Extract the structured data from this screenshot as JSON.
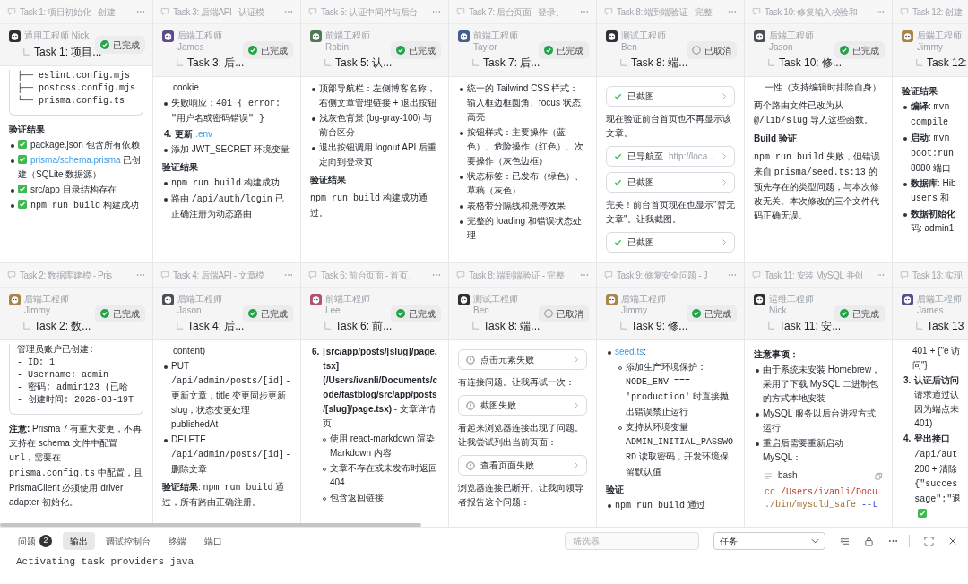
{
  "cards": [
    {
      "title": "Task 1: 项目初始化 - 创建",
      "more_button": true,
      "agent": {
        "role": "通用工程师 Nick",
        "color": "#2f2f33"
      },
      "subtask": "Task 1: 项目...",
      "cancelled": false,
      "status": "已完成",
      "body": [
        {
          "kind": "code",
          "lines": [
            "├── eslint.config.mjs",
            "├── postcss.config.mjs",
            "└── prisma.config.ts"
          ]
        },
        {
          "kind": "heading",
          "text": "验证结果"
        },
        {
          "kind": "bullet",
          "check": true,
          "parts": [
            {
              "text": "package.json 包含所有依赖",
              "kind": "plain"
            }
          ]
        },
        {
          "kind": "bullet",
          "check": true,
          "parts": [
            {
              "text": "prisma/schema.prisma",
              "kind": "link"
            },
            {
              "text": " 已创建（SQLite 数据源）",
              "kind": "plain"
            }
          ]
        },
        {
          "kind": "bullet",
          "check": true,
          "parts": [
            {
              "text": "src/app 目录结构存在",
              "kind": "plain"
            }
          ]
        },
        {
          "kind": "bullet",
          "check": true,
          "parts": [
            {
              "text": "npm run build",
              "kind": "code"
            },
            {
              "text": " 构建成功",
              "kind": "plain"
            }
          ]
        }
      ]
    },
    {
      "title": "Task 3: 后端API - 认证模",
      "more_button": true,
      "agent": {
        "role": "后端工程师 James",
        "color": "#5b4a8c"
      },
      "subtask": "Task 3: 后...",
      "cancelled": false,
      "status": "已完成",
      "body": [
        {
          "kind": "cont",
          "parts": [
            {
              "text": "cookie",
              "kind": "plain"
            }
          ]
        },
        {
          "kind": "bullet",
          "parts": [
            {
              "text": "失败响应：",
              "kind": "plain"
            },
            {
              "text": "401 { error: \"用户名或密码错误\" }",
              "kind": "code"
            }
          ]
        },
        {
          "kind": "numbered",
          "number": "4.",
          "parts": [
            {
              "text": "更新 ",
              "kind": "bold"
            },
            {
              "text": ".env",
              "kind": "link"
            }
          ]
        },
        {
          "kind": "bullet",
          "parts": [
            {
              "text": "添加 JWT_SECRET 环境变量",
              "kind": "plain"
            }
          ]
        },
        {
          "kind": "heading",
          "text": "验证结果"
        },
        {
          "kind": "bullet",
          "parts": [
            {
              "text": "npm run build",
              "kind": "code"
            },
            {
              "text": " 构建成功",
              "kind": "plain"
            }
          ]
        },
        {
          "kind": "bullet",
          "parts": [
            {
              "text": "路由 ",
              "kind": "plain"
            },
            {
              "text": "/api/auth/login",
              "kind": "code"
            },
            {
              "text": " 已正确注册为动态路由",
              "kind": "plain"
            }
          ]
        }
      ]
    },
    {
      "title": "Task 5: 认证中间件与后台",
      "more_button": true,
      "agent": {
        "role": "前端工程师 Robin",
        "color": "#4d7a52"
      },
      "subtask": "Task 5: 认...",
      "cancelled": false,
      "status": "已完成",
      "body": [
        {
          "kind": "bullet",
          "parts": [
            {
              "text": "顶部导航栏：左侧博客名称，右侧文章管理链接 + 退出按钮",
              "kind": "plain"
            }
          ]
        },
        {
          "kind": "bullet",
          "parts": [
            {
              "text": "浅灰色背景 (bg-gray-100) 与前台区分",
              "kind": "plain"
            }
          ]
        },
        {
          "kind": "bullet",
          "parts": [
            {
              "text": "退出按钮调用 logout API 后重定向到登录页",
              "kind": "plain"
            }
          ]
        },
        {
          "kind": "heading",
          "text": "验证结果"
        },
        {
          "kind": "para",
          "parts": [
            {
              "text": "npm run build",
              "kind": "code"
            },
            {
              "text": " 构建成功通过。",
              "kind": "plain"
            }
          ]
        }
      ]
    },
    {
      "title": "Task 7: 后台页面 - 登录、",
      "more_button": true,
      "agent": {
        "role": "前端工程师 Taylor",
        "color": "#3e5f8f"
      },
      "subtask": "Task 7: 后...",
      "cancelled": false,
      "status": "已完成",
      "body": [
        {
          "kind": "bullet",
          "parts": [
            {
              "text": "统一的 Tailwind CSS 样式：输入框边框圆角、focus 状态高亮",
              "kind": "plain"
            }
          ]
        },
        {
          "kind": "bullet",
          "parts": [
            {
              "text": "按钮样式：主要操作（蓝色）、危险操作（红色）、次要操作（灰色边框）",
              "kind": "plain"
            }
          ]
        },
        {
          "kind": "bullet",
          "parts": [
            {
              "text": "状态标签：已发布（绿色）、草稿（灰色）",
              "kind": "plain"
            }
          ]
        },
        {
          "kind": "bullet",
          "parts": [
            {
              "text": "表格带分隔线和悬停效果",
              "kind": "plain"
            }
          ]
        },
        {
          "kind": "bullet",
          "parts": [
            {
              "text": "完整的 loading 和错误状态处理",
              "kind": "plain"
            }
          ]
        }
      ]
    },
    {
      "title": "Task 8: 端到端验证 - 完整",
      "more_button": true,
      "agent": {
        "role": "测试工程师 Ben",
        "color": "#2f2f33"
      },
      "subtask": "Task 8: 端...",
      "cancelled": true,
      "status": "已取消",
      "body": [
        {
          "kind": "tool",
          "failed": false,
          "label": "已截图"
        },
        {
          "kind": "para",
          "parts": [
            {
              "text": "现在验证前台首页也不再显示该文章。",
              "kind": "plain"
            }
          ]
        },
        {
          "kind": "tool",
          "failed": false,
          "label": "已导航至",
          "detail": "http://loca..."
        },
        {
          "kind": "tool",
          "failed": false,
          "label": "已截图"
        },
        {
          "kind": "para",
          "parts": [
            {
              "text": "完美！前台首页现在也显示\"暂无文章\"。让我截图。",
              "kind": "plain"
            }
          ]
        },
        {
          "kind": "tool",
          "failed": false,
          "label": "已截图"
        }
      ]
    },
    {
      "title": "Task 10: 修复输入校验和",
      "more_button": true,
      "agent": {
        "role": "后端工程师 Jason",
        "color": "#4a4f55"
      },
      "subtask": "Task 10: 修...",
      "cancelled": false,
      "status": "已完成",
      "body": [
        {
          "kind": "cont",
          "parts": [
            {
              "text": "一性（支持编辑时排除自身）",
              "kind": "plain"
            }
          ]
        },
        {
          "kind": "para",
          "parts": [
            {
              "text": "两个路由文件已改为从 ",
              "kind": "plain"
            },
            {
              "text": "@/lib/slug",
              "kind": "code"
            },
            {
              "text": " 导入这些函数。",
              "kind": "plain"
            }
          ]
        },
        {
          "kind": "heading",
          "text": "Build 验证"
        },
        {
          "kind": "para",
          "parts": [
            {
              "text": "npm run build",
              "kind": "code"
            },
            {
              "text": " 失败，但错误来自 ",
              "kind": "plain"
            },
            {
              "text": "prisma/seed.ts:13",
              "kind": "code"
            },
            {
              "text": " 的预先存在的类型问题，与本次修改无关。本次修改的三个文件代码正确无误。",
              "kind": "plain"
            }
          ]
        }
      ]
    },
    {
      "title": "Task 12: 创建",
      "agent": {
        "role": "后端工程师 Jimmy",
        "color": "#a8864a"
      },
      "subtask": "Task 12:",
      "body": [
        {
          "kind": "heading",
          "text": "验证结果"
        },
        {
          "kind": "bullet",
          "parts": [
            {
              "text": "编译",
              "kind": "bold"
            },
            {
              "text": ": ",
              "kind": "plain"
            },
            {
              "text": "mvn compile",
              "kind": "code"
            }
          ]
        },
        {
          "kind": "bullet",
          "parts": [
            {
              "text": "启动",
              "kind": "bold"
            },
            {
              "text": ": ",
              "kind": "plain"
            },
            {
              "text": "mvn boot:run",
              "kind": "code"
            },
            {
              "text": " 8080 端口",
              "kind": "plain"
            }
          ]
        },
        {
          "kind": "bullet",
          "parts": [
            {
              "text": "数据库",
              "kind": "bold"
            },
            {
              "text": ": Hib ",
              "kind": "plain"
            },
            {
              "text": "users",
              "kind": "code"
            },
            {
              "text": " 和",
              "kind": "plain"
            }
          ]
        },
        {
          "kind": "bullet",
          "parts": [
            {
              "text": "数据初始化",
              "kind": "bold"
            },
            {
              "text": " 码: admin1",
              "kind": "plain"
            }
          ]
        }
      ]
    },
    {
      "title": "Task 2: 数据库建模 - Pris",
      "more_button": true,
      "agent": {
        "role": "后端工程师 Jimmy",
        "color": "#a8864a"
      },
      "subtask": "Task 2: 数...",
      "cancelled": false,
      "status": "已完成",
      "body": [
        {
          "kind": "code",
          "lines": [
            "管理员账户已创建:",
            "- ID: 1",
            "- Username: admin",
            "- 密码: admin123 (已哈",
            "- 创建时间: 2026-03-19T"
          ]
        },
        {
          "kind": "para",
          "parts": [
            {
              "text": "注意:",
              "kind": "bold"
            },
            {
              "text": "  Prisma 7 有重大变更，不再支持在 schema 文件中配置 ",
              "kind": "plain"
            },
            {
              "text": "url",
              "kind": "code"
            },
            {
              "text": "，需要在 ",
              "kind": "plain"
            },
            {
              "text": "prisma.config.ts",
              "kind": "code"
            },
            {
              "text": " 中配置，且 PrismaClient 必须使用 driver adapter 初始化。",
              "kind": "plain"
            }
          ]
        }
      ]
    },
    {
      "title": "Task 4: 后端API - 文章模",
      "more_button": true,
      "agent": {
        "role": "后端工程师 Jason",
        "color": "#4a4f55"
      },
      "subtask": "Task 4: 后...",
      "cancelled": false,
      "status": "已完成",
      "body": [
        {
          "kind": "cont",
          "parts": [
            {
              "text": "content)",
              "kind": "plain"
            }
          ]
        },
        {
          "kind": "bullet",
          "parts": [
            {
              "text": "PUT ",
              "kind": "plain"
            },
            {
              "text": "/api/admin/posts/[id]",
              "kind": "code"
            },
            {
              "text": " - 更新文章，title 变更同步更新 slug，状态变更处理 publishedAt",
              "kind": "plain"
            }
          ]
        },
        {
          "kind": "bullet",
          "parts": [
            {
              "text": "DELETE ",
              "kind": "plain"
            },
            {
              "text": "/api/admin/posts/[id]",
              "kind": "code"
            },
            {
              "text": " - 删除文章",
              "kind": "plain"
            }
          ]
        },
        {
          "kind": "para",
          "parts": [
            {
              "text": "验证结果",
              "kind": "bold"
            },
            {
              "text": ": ",
              "kind": "plain"
            },
            {
              "text": "npm run build",
              "kind": "code"
            },
            {
              "text": " 通过，所有路由正确注册。",
              "kind": "plain"
            }
          ]
        }
      ]
    },
    {
      "title": "Task 6: 前台页面 - 首页、",
      "more_button": true,
      "agent": {
        "role": "前端工程师 Lee",
        "color": "#b0546e"
      },
      "subtask": "Task 6: 前...",
      "cancelled": false,
      "status": "已完成",
      "body": [
        {
          "kind": "numbered",
          "number": "6.",
          "parts": [
            {
              "text": "[src/app/posts/[slug]/page.tsx](/Users/ivanli/Documents/code/fastblog/src/app/posts/[slug]/page.tsx)",
              "kind": "bold"
            },
            {
              "text": " - 文章详情页",
              "kind": "plain"
            }
          ],
          "children": [
            {
              "kind": "bullet",
              "parts": [
                {
                  "text": "使用 react-markdown 渲染 Markdown 内容",
                  "kind": "plain"
                }
              ]
            },
            {
              "kind": "bullet",
              "parts": [
                {
                  "text": "文章不存在或未发布时返回 404",
                  "kind": "plain"
                }
              ]
            },
            {
              "kind": "bullet",
              "parts": [
                {
                  "text": "包含返回链接",
                  "kind": "plain"
                }
              ]
            }
          ]
        }
      ]
    },
    {
      "title": "Task 8: 端到端验证 - 完整",
      "more_button": true,
      "agent": {
        "role": "测试工程师 Ben",
        "color": "#2f2f33"
      },
      "subtask": "Task 8: 端...",
      "cancelled": true,
      "status": "已取消",
      "body": [
        {
          "kind": "tool",
          "failed": true,
          "label": "点击元素失败"
        },
        {
          "kind": "para",
          "parts": [
            {
              "text": "有连接问题。让我再试一次：",
              "kind": "plain"
            }
          ]
        },
        {
          "kind": "tool",
          "failed": true,
          "label": "截图失败"
        },
        {
          "kind": "para",
          "parts": [
            {
              "text": "看起来浏览器连接出现了问题。让我尝试列出当前页面：",
              "kind": "plain"
            }
          ]
        },
        {
          "kind": "tool",
          "failed": true,
          "label": "查看页面失败"
        },
        {
          "kind": "para",
          "parts": [
            {
              "text": "浏览器连接已断开。让我向领导者报告这个问题：",
              "kind": "plain"
            }
          ]
        }
      ]
    },
    {
      "title": "Task 9: 修复安全问题 - J",
      "more_button": true,
      "agent": {
        "role": "后端工程师 Jimmy",
        "color": "#a8864a"
      },
      "subtask": "Task 9: 修...",
      "cancelled": false,
      "status": "已完成",
      "body": [
        {
          "kind": "bullet",
          "parts": [
            {
              "text": "seed.ts",
              "kind": "link"
            },
            {
              "text": ":",
              "kind": "plain"
            }
          ],
          "children": [
            {
              "kind": "bullet",
              "parts": [
                {
                  "text": "添加生产环境保护：",
                  "kind": "plain"
                },
                {
                  "text": "NODE_ENV === 'production'",
                  "kind": "code"
                },
                {
                  "text": " 时直接抛出错误禁止运行",
                  "kind": "plain"
                }
              ]
            },
            {
              "kind": "bullet",
              "parts": [
                {
                  "text": "支持从环境变量 ",
                  "kind": "plain"
                },
                {
                  "text": "ADMIN_INITIAL_PASSWORD",
                  "kind": "code"
                },
                {
                  "text": " 读取密码，开发环境保留默认值",
                  "kind": "plain"
                }
              ]
            }
          ]
        },
        {
          "kind": "heading",
          "text": "验证"
        },
        {
          "kind": "bullet",
          "parts": [
            {
              "text": "npm run build",
              "kind": "code"
            },
            {
              "text": " 通过",
              "kind": "plain"
            }
          ]
        }
      ]
    },
    {
      "title": "Task 11: 安装 MySQL 并创",
      "more_button": true,
      "agent": {
        "role": "运维工程师 Nick",
        "color": "#2f2f33"
      },
      "subtask": "Task 11: 安...",
      "cancelled": false,
      "status": "已完成",
      "body": [
        {
          "kind": "heading",
          "text": "注意事项："
        },
        {
          "kind": "bullet",
          "parts": [
            {
              "text": "由于系统未安装 Homebrew，采用了下载 MySQL 二进制包的方式本地安装",
              "kind": "plain"
            }
          ]
        },
        {
          "kind": "bullet",
          "parts": [
            {
              "text": "MySQL 服务以后台进程方式运行",
              "kind": "plain"
            }
          ]
        },
        {
          "kind": "bullet",
          "parts": [
            {
              "text": "重启后需要重新启动 MySQL：",
              "kind": "plain"
            }
          ]
        },
        {
          "kind": "shell",
          "lang": "bash",
          "lines": [
            [
              {
                "text": "cd ",
                "kind": "command"
              },
              {
                "text": "/Users/ivanli/Docu",
                "kind": "path"
              }
            ],
            [
              {
                "text": "./bin/mysqld_safe ",
                "kind": "command"
              },
              {
                "text": "--t",
                "kind": "flag"
              }
            ]
          ]
        }
      ]
    },
    {
      "title": "Task 13: 实现",
      "agent": {
        "role": "后端工程师 James",
        "color": "#5b4a8c"
      },
      "subtask": "Task 13",
      "body": [
        {
          "kind": "cont",
          "parts": [
            {
              "text": "401 + {\"e 访问\"}",
              "kind": "plain"
            }
          ]
        },
        {
          "kind": "numbered",
          "number": "3.",
          "parts": [
            {
              "text": "认证后访问",
              "kind": "bold"
            },
            {
              "text": " 请求通过认因为端点未401)",
              "kind": "plain"
            }
          ]
        },
        {
          "kind": "numbered",
          "number": "4.",
          "check": true,
          "parts": [
            {
              "text": "登出接口",
              "kind": "bold"
            },
            {
              "text": " /api/aut",
              "kind": "code"
            },
            {
              "text": " 200 + 清除 ",
              "kind": "plain"
            },
            {
              "text": "{\"succes sage\":\"退",
              "kind": "code"
            }
          ]
        }
      ]
    }
  ],
  "panel": {
    "tabs": [
      {
        "label": "问题",
        "count": "2",
        "selected": false
      },
      {
        "label": "输出",
        "selected": true
      },
      {
        "label": "调试控制台",
        "selected": false
      },
      {
        "label": "终端",
        "selected": false
      },
      {
        "label": "端口",
        "selected": false
      }
    ],
    "filter": {
      "placeholder": "筛选器"
    },
    "channel": "任务",
    "output": "Activating task providers java"
  }
}
